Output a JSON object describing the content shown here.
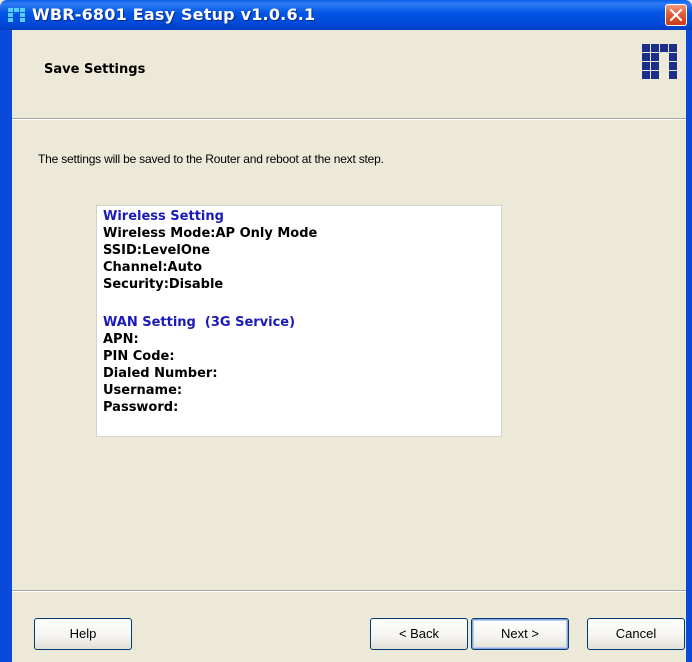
{
  "window": {
    "title": "WBR-6801 Easy Setup v1.0.6.1"
  },
  "header": {
    "title": "Save Settings"
  },
  "main": {
    "intro": "The settings will be saved to the Router and reboot at the next step.",
    "wireless": {
      "heading": "Wireless Setting",
      "mode": "Wireless Mode:AP Only Mode",
      "ssid": "SSID:LevelOne",
      "channel": "Channel:Auto",
      "security": "Security:Disable"
    },
    "wan": {
      "heading": "WAN Setting  (3G Service)",
      "apn": "APN:",
      "pin": "PIN Code:",
      "dialed": "Dialed Number:",
      "username": "Username:",
      "password": "Password:"
    }
  },
  "buttons": {
    "help": "Help",
    "back": "< Back",
    "next": "Next >",
    "cancel": "Cancel"
  },
  "colors": {
    "titlebar": "#0055e5",
    "section_heading": "#1a1ab8",
    "face": "#ece9d8",
    "close": "#e15b36"
  }
}
